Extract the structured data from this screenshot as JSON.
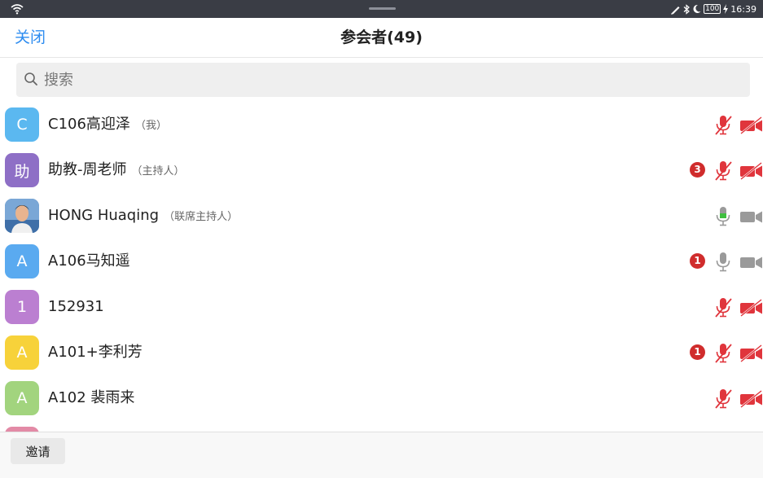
{
  "status_bar": {
    "time": "16:39",
    "battery": "100",
    "icons": [
      "wifi-icon",
      "pen-icon",
      "bluetooth-icon",
      "moon-icon",
      "battery-icon",
      "charging-icon"
    ]
  },
  "header": {
    "close_label": "关闭",
    "title": "参会者(49)"
  },
  "search": {
    "placeholder": "搜索",
    "value": ""
  },
  "participants": [
    {
      "avatar_text": "C",
      "avatar_color": "#5bb8f0",
      "name": "C106高迎泽",
      "role": "（我）",
      "badge": "",
      "mic": "muted",
      "video": "off"
    },
    {
      "avatar_text": "助",
      "avatar_color": "#8e6fc6",
      "name": "助教-周老师",
      "role": "（主持人）",
      "badge": "3",
      "mic": "muted",
      "video": "off"
    },
    {
      "avatar_text": "",
      "avatar_color": "#4a7fb5",
      "avatar_photo": true,
      "name": "HONG Huaqing",
      "role": "（联席主持人）",
      "badge": "",
      "mic": "active",
      "video": "on"
    },
    {
      "avatar_text": "A",
      "avatar_color": "#5aaaf0",
      "name": "A106马知遥",
      "role": "",
      "badge": "1",
      "mic": "on",
      "video": "on"
    },
    {
      "avatar_text": "1",
      "avatar_color": "#bb7fd1",
      "name": "152931",
      "role": "",
      "badge": "",
      "mic": "muted",
      "video": "off"
    },
    {
      "avatar_text": "A",
      "avatar_color": "#f7d23a",
      "name": "A101+李利芳",
      "role": "",
      "badge": "1",
      "mic": "muted",
      "video": "off"
    },
    {
      "avatar_text": "A",
      "avatar_color": "#a2d47e",
      "name": "A102 裴雨来",
      "role": "",
      "badge": "",
      "mic": "muted",
      "video": "off"
    }
  ],
  "footer": {
    "invite_label": "邀请"
  },
  "colors": {
    "accent": "#2d8cf0",
    "muted_red": "#e0353c",
    "speaking_green": "#3fbf3f",
    "icon_gray": "#9a9a9a"
  }
}
